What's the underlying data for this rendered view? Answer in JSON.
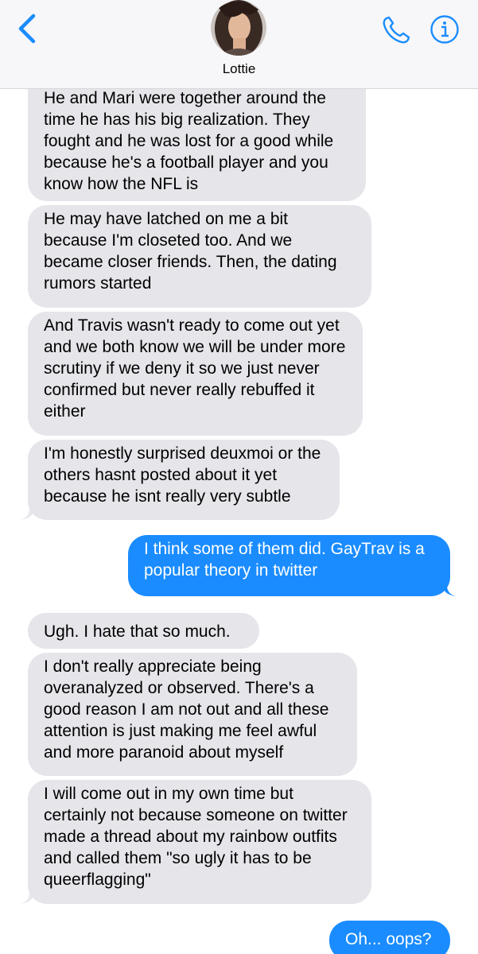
{
  "header": {
    "contact_name": "Lottie",
    "back_icon": "chevron-left-icon",
    "call_icon": "phone-icon",
    "info_icon": "info-icon",
    "accent_color": "#1a8cff"
  },
  "messages": [
    {
      "sender": "contact",
      "text": "He and Mari were together around the time he has his big realization. They fought and he was lost for a good while because he's a football player and you know how the NFL is"
    },
    {
      "sender": "contact",
      "text": "He may have latched on me a bit because I'm closeted too. And we became closer friends. Then, the dating rumors started"
    },
    {
      "sender": "contact",
      "text": "And Travis wasn't ready to come out yet and we both know we will be under more scrutiny if we deny it so we just never confirmed but never really rebuffed it either"
    },
    {
      "sender": "contact",
      "text": "I'm honestly surprised deuxmoi or the others hasnt posted about it yet because he isnt really very subtle"
    },
    {
      "sender": "me",
      "text": "I think some of them did. GayTrav is a popular theory in twitter"
    },
    {
      "sender": "contact",
      "text": "Ugh. I hate that so much."
    },
    {
      "sender": "contact",
      "text": "I don't really appreciate being overanalyzed or observed. There's a good reason I am not out and all these attention is just making me feel awful and more paranoid about myself"
    },
    {
      "sender": "contact",
      "text": "I will come out in my own time but certainly not because someone on twitter made a thread about my rainbow outfits and called them \"so ugly it has to be queerflagging\""
    },
    {
      "sender": "me",
      "text": "Oh... oops?"
    }
  ],
  "colors": {
    "incoming_bubble": "#e5e5ea",
    "outgoing_bubble": "#1a8cff"
  }
}
